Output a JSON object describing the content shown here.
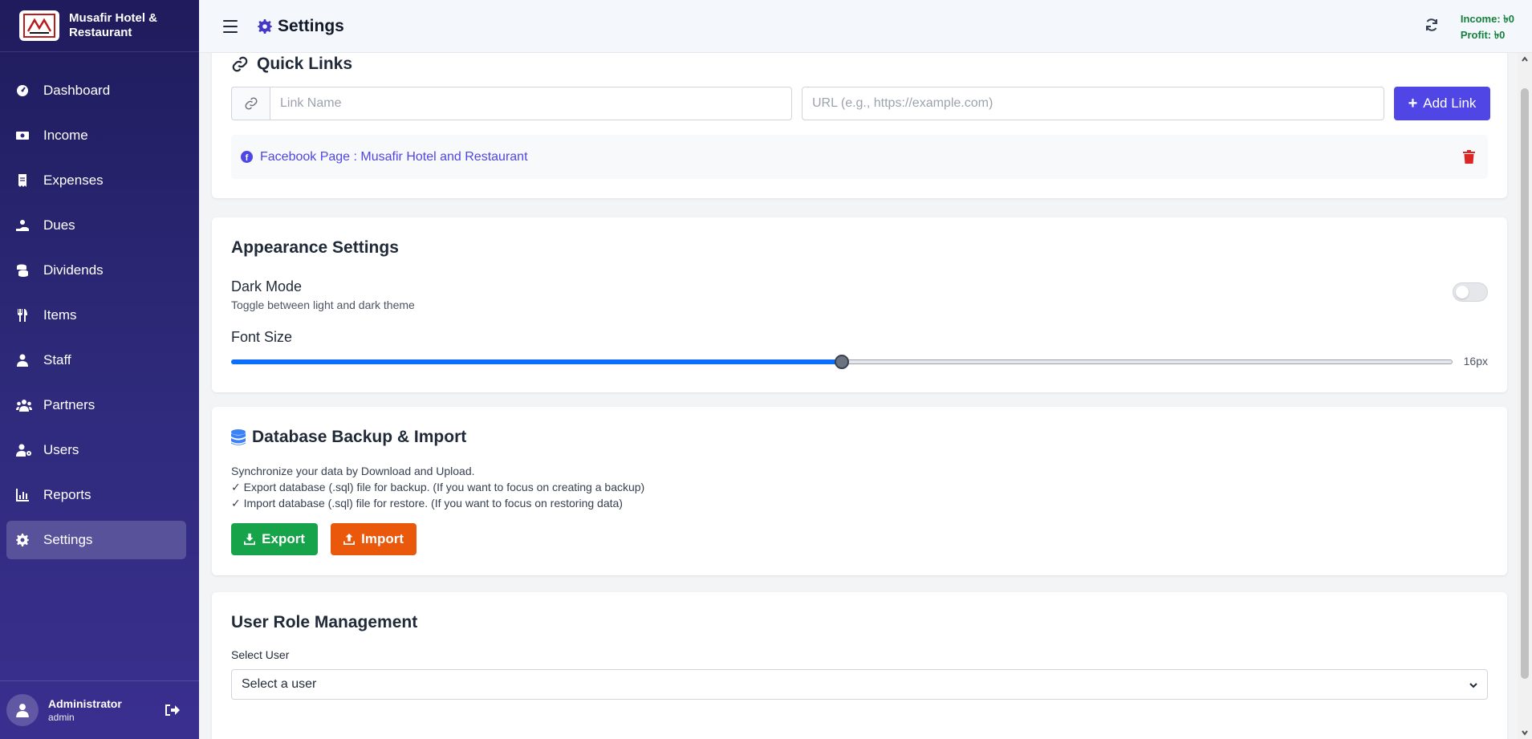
{
  "app": {
    "brand_name_line1": "Musafir Hotel &",
    "brand_name_line2": "Restaurant"
  },
  "sidebar": {
    "items": [
      {
        "label": "Dashboard",
        "icon": "dashboard-icon"
      },
      {
        "label": "Income",
        "icon": "money-bill-icon"
      },
      {
        "label": "Expenses",
        "icon": "receipt-icon"
      },
      {
        "label": "Dues",
        "icon": "hand-holding-icon"
      },
      {
        "label": "Dividends",
        "icon": "coins-icon"
      },
      {
        "label": "Items",
        "icon": "utensils-icon"
      },
      {
        "label": "Staff",
        "icon": "user-tie-icon"
      },
      {
        "label": "Partners",
        "icon": "users-icon"
      },
      {
        "label": "Users",
        "icon": "user-cog-icon"
      },
      {
        "label": "Reports",
        "icon": "chart-bar-icon"
      },
      {
        "label": "Settings",
        "icon": "gear-icon",
        "active": true
      }
    ],
    "user": {
      "name": "Administrator",
      "role": "admin"
    }
  },
  "header": {
    "title": "Settings",
    "income": "Income: ৳0",
    "profit": "Profit: ৳0"
  },
  "quick_links": {
    "title": "Quick Links",
    "name_placeholder": "Link Name",
    "url_placeholder": "URL (e.g., https://example.com)",
    "add_label": "Add Link",
    "links": [
      {
        "text": "Facebook Page : Musafir Hotel and Restaurant"
      }
    ]
  },
  "appearance": {
    "title": "Appearance Settings",
    "dark_mode_label": "Dark Mode",
    "dark_mode_sub": "Toggle between light and dark theme",
    "dark_mode_on": false,
    "font_size_label": "Font Size",
    "font_size_value": "16px",
    "font_size_fraction": 0.5
  },
  "database": {
    "title": "Database Backup & Import",
    "line1": "Synchronize your data by Download and Upload.",
    "line2": "✓ Export database (.sql) file for backup. (If you want to focus on creating a backup)",
    "line3": "✓ Import database (.sql) file for restore. (If you want to focus on restoring data)",
    "export_label": "Export",
    "import_label": "Import"
  },
  "user_roles": {
    "title": "User Role Management",
    "select_label": "Select User",
    "select_value": "Select a user"
  },
  "colors": {
    "accent": "#4f46e5",
    "export": "#16a34a",
    "import": "#ea580c",
    "danger": "#dc2626",
    "profit_text": "#15803d"
  }
}
